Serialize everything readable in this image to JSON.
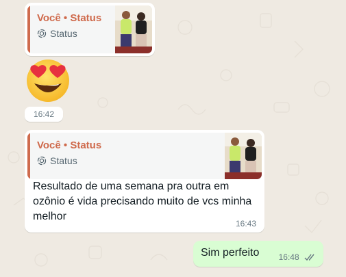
{
  "messages": [
    {
      "quote_title": "Você • Status",
      "quote_sub": "Status",
      "time": ""
    },
    {
      "emoji": "heart-eyes-emoji",
      "time": "16:42"
    },
    {
      "quote_title": "Você • Status",
      "quote_sub": "Status",
      "text": "Resultado de uma semana pra outra em ozônio é vida  precisando muito de vcs minha melhor",
      "time": "16:43"
    },
    {
      "text": "Sim perfeito",
      "time": "16:48",
      "status": "read-double-check"
    }
  ],
  "colors": {
    "background": "#efeae2",
    "incoming": "#ffffff",
    "outgoing": "#d9fdd3",
    "quote_accent": "#cf6a4c",
    "read_ticks": "#667781"
  }
}
